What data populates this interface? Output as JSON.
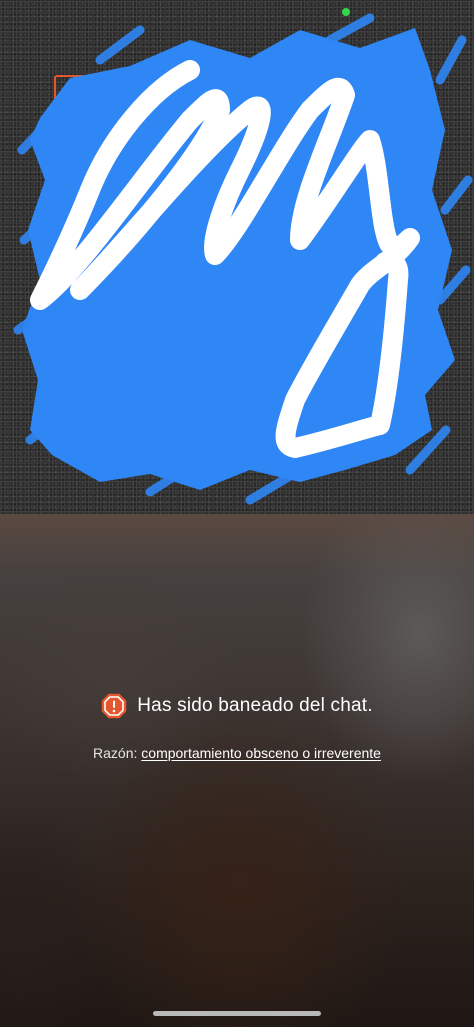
{
  "status": {
    "camera_indicator_color": "#32d74b"
  },
  "local_video": {
    "frame_color": "#e4572e",
    "scribble_colors": [
      "#2f86f5",
      "#ffffff"
    ]
  },
  "ban_notice": {
    "message": "Has sido baneado del chat.",
    "icon": "warning-icon",
    "icon_color": "#e4572e",
    "reason_label": "Razón:",
    "reason_value": "comportamiento obsceno o irreverente"
  }
}
